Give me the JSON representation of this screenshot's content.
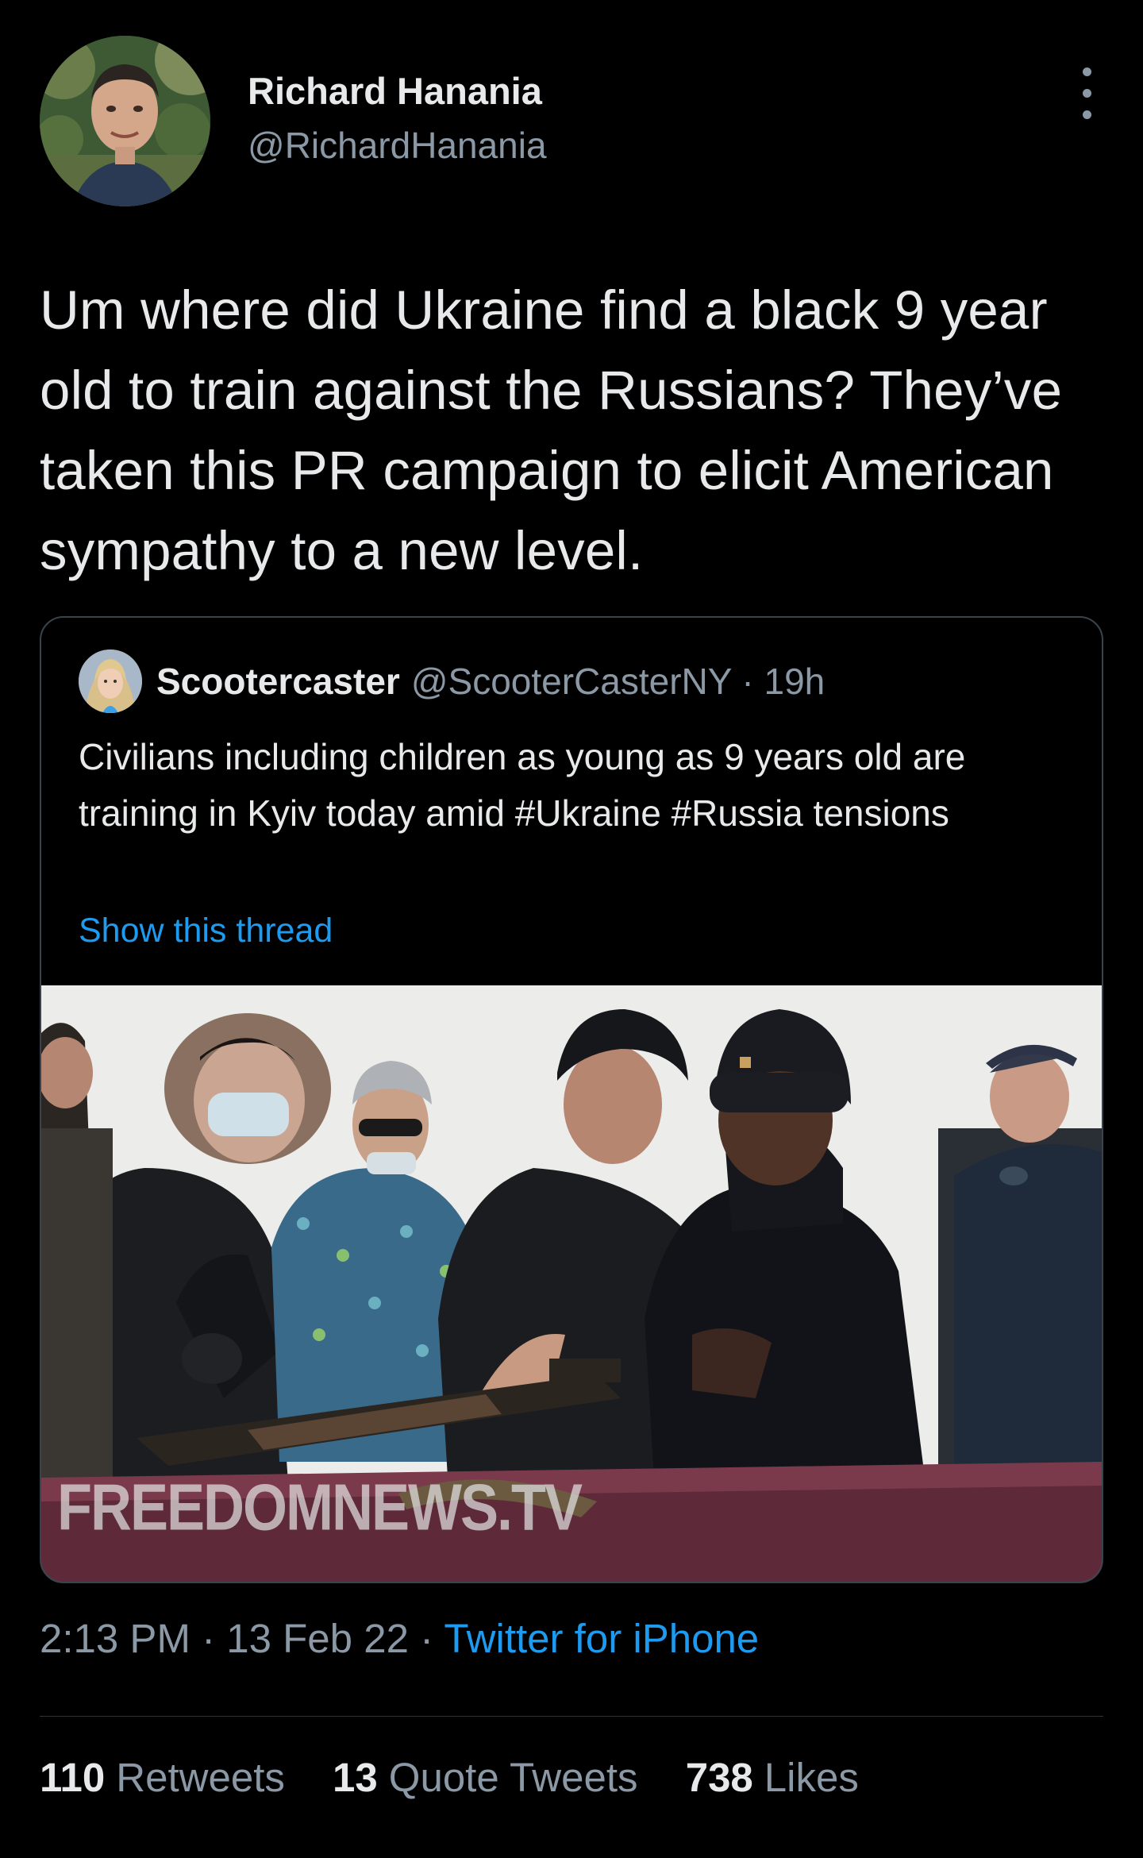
{
  "author": {
    "display_name": "Richard Hanania",
    "handle": "@RichardHanania",
    "avatar_icon": "user-avatar"
  },
  "more_icon": "more-vertical-icon",
  "tweet_text": "Um where did Ukraine find a black 9 year old to train against the Russians? They’ve taken this PR campaign to elicit American sympathy to a new level.",
  "quoted": {
    "display_name": "Scootercaster",
    "handle_time": "@ScooterCasterNY · 19h",
    "text": "Civilians including children as young as 9 years old are training in Kyiv today amid #Ukraine #Russia tensions",
    "show_thread": "Show this thread",
    "media_watermark": "FREEDOMNEWS.TV"
  },
  "meta": {
    "timestamp": "2:13 PM · 13 Feb 22 · ",
    "source": "Twitter for iPhone"
  },
  "stats": [
    {
      "count": "110",
      "label": "Retweets"
    },
    {
      "count": "13",
      "label": "Quote Tweets"
    },
    {
      "count": "738",
      "label": "Likes"
    }
  ],
  "colors": {
    "background": "#000000",
    "text": "#e7e9ea",
    "secondary": "#8b98a5",
    "link": "#1d9bf0",
    "border": "#38444d"
  }
}
